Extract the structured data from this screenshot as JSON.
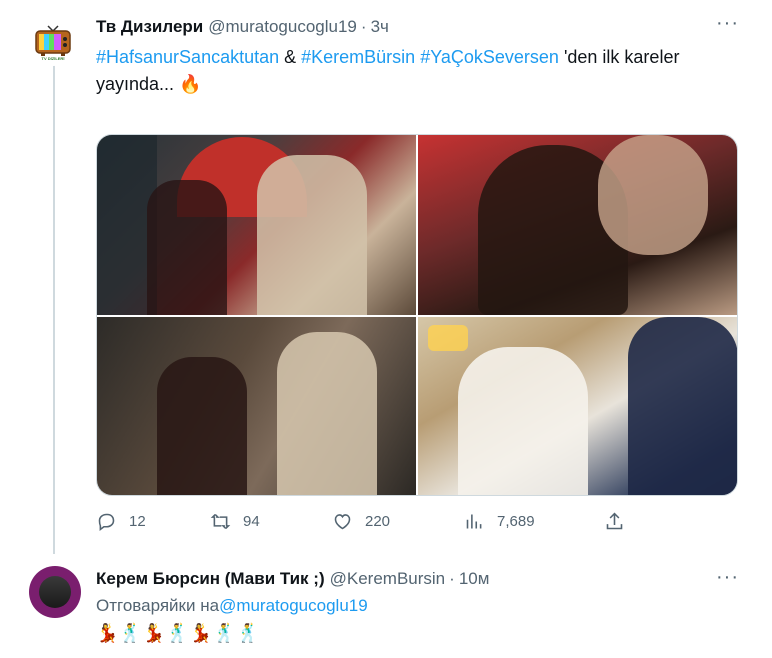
{
  "tweet": {
    "author_name": "Тв Дизилери",
    "handle": "@muratogucoglu19",
    "dot": "·",
    "time": "3ч",
    "more": "···",
    "avatar_label": "TV DİZİLERİ",
    "text_parts": {
      "tag1": "#HafsanurSancaktutan",
      "amp": " & ",
      "tag2": "#KeremBürsin",
      "space": " ",
      "tag3": "#YaÇokSeversen",
      "rest": " 'den ilk kareler yayında... 🔥"
    },
    "actions": {
      "replies": "12",
      "retweets": "94",
      "likes": "220",
      "views": "7,689"
    }
  },
  "reply": {
    "author_name": "Керем Бюрсин (Мави Тик ;)",
    "handle": "@KeremBursin",
    "dot": "·",
    "time": "10м",
    "more": "···",
    "text_prefix": "Отговаряйки на",
    "mention": "@muratogucoglu19",
    "emoji": "💃🕺💃🕺💃🕺🕺"
  },
  "colors": {
    "link": "#1d9bf0",
    "secondary": "#536471",
    "border": "#cfd9de"
  }
}
